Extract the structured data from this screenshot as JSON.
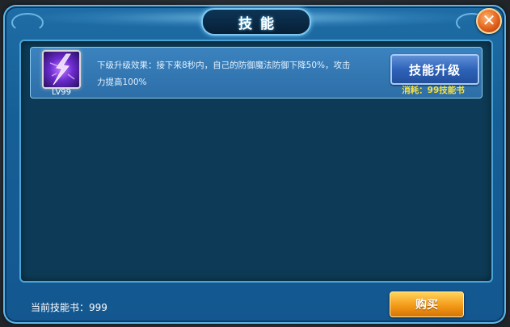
{
  "dialog": {
    "title": "技能",
    "close_icon": "close-x-icon"
  },
  "skills": [
    {
      "icon": "lightning-skill-icon",
      "level": "LV99",
      "description_line1": "下级升级效果：接下来8秒内，自己的防御魔法防御下降50%，攻击",
      "description_line2": "力提高100%",
      "upgrade_label": "技能升级",
      "cost": "消耗：99技能书"
    }
  ],
  "footer": {
    "book_count": "当前技能书：999",
    "buy_label": "购买"
  },
  "colors": {
    "accent_gold": "#f7e03a",
    "panel_blue": "#165f96",
    "buy_orange": "#f39a18"
  }
}
